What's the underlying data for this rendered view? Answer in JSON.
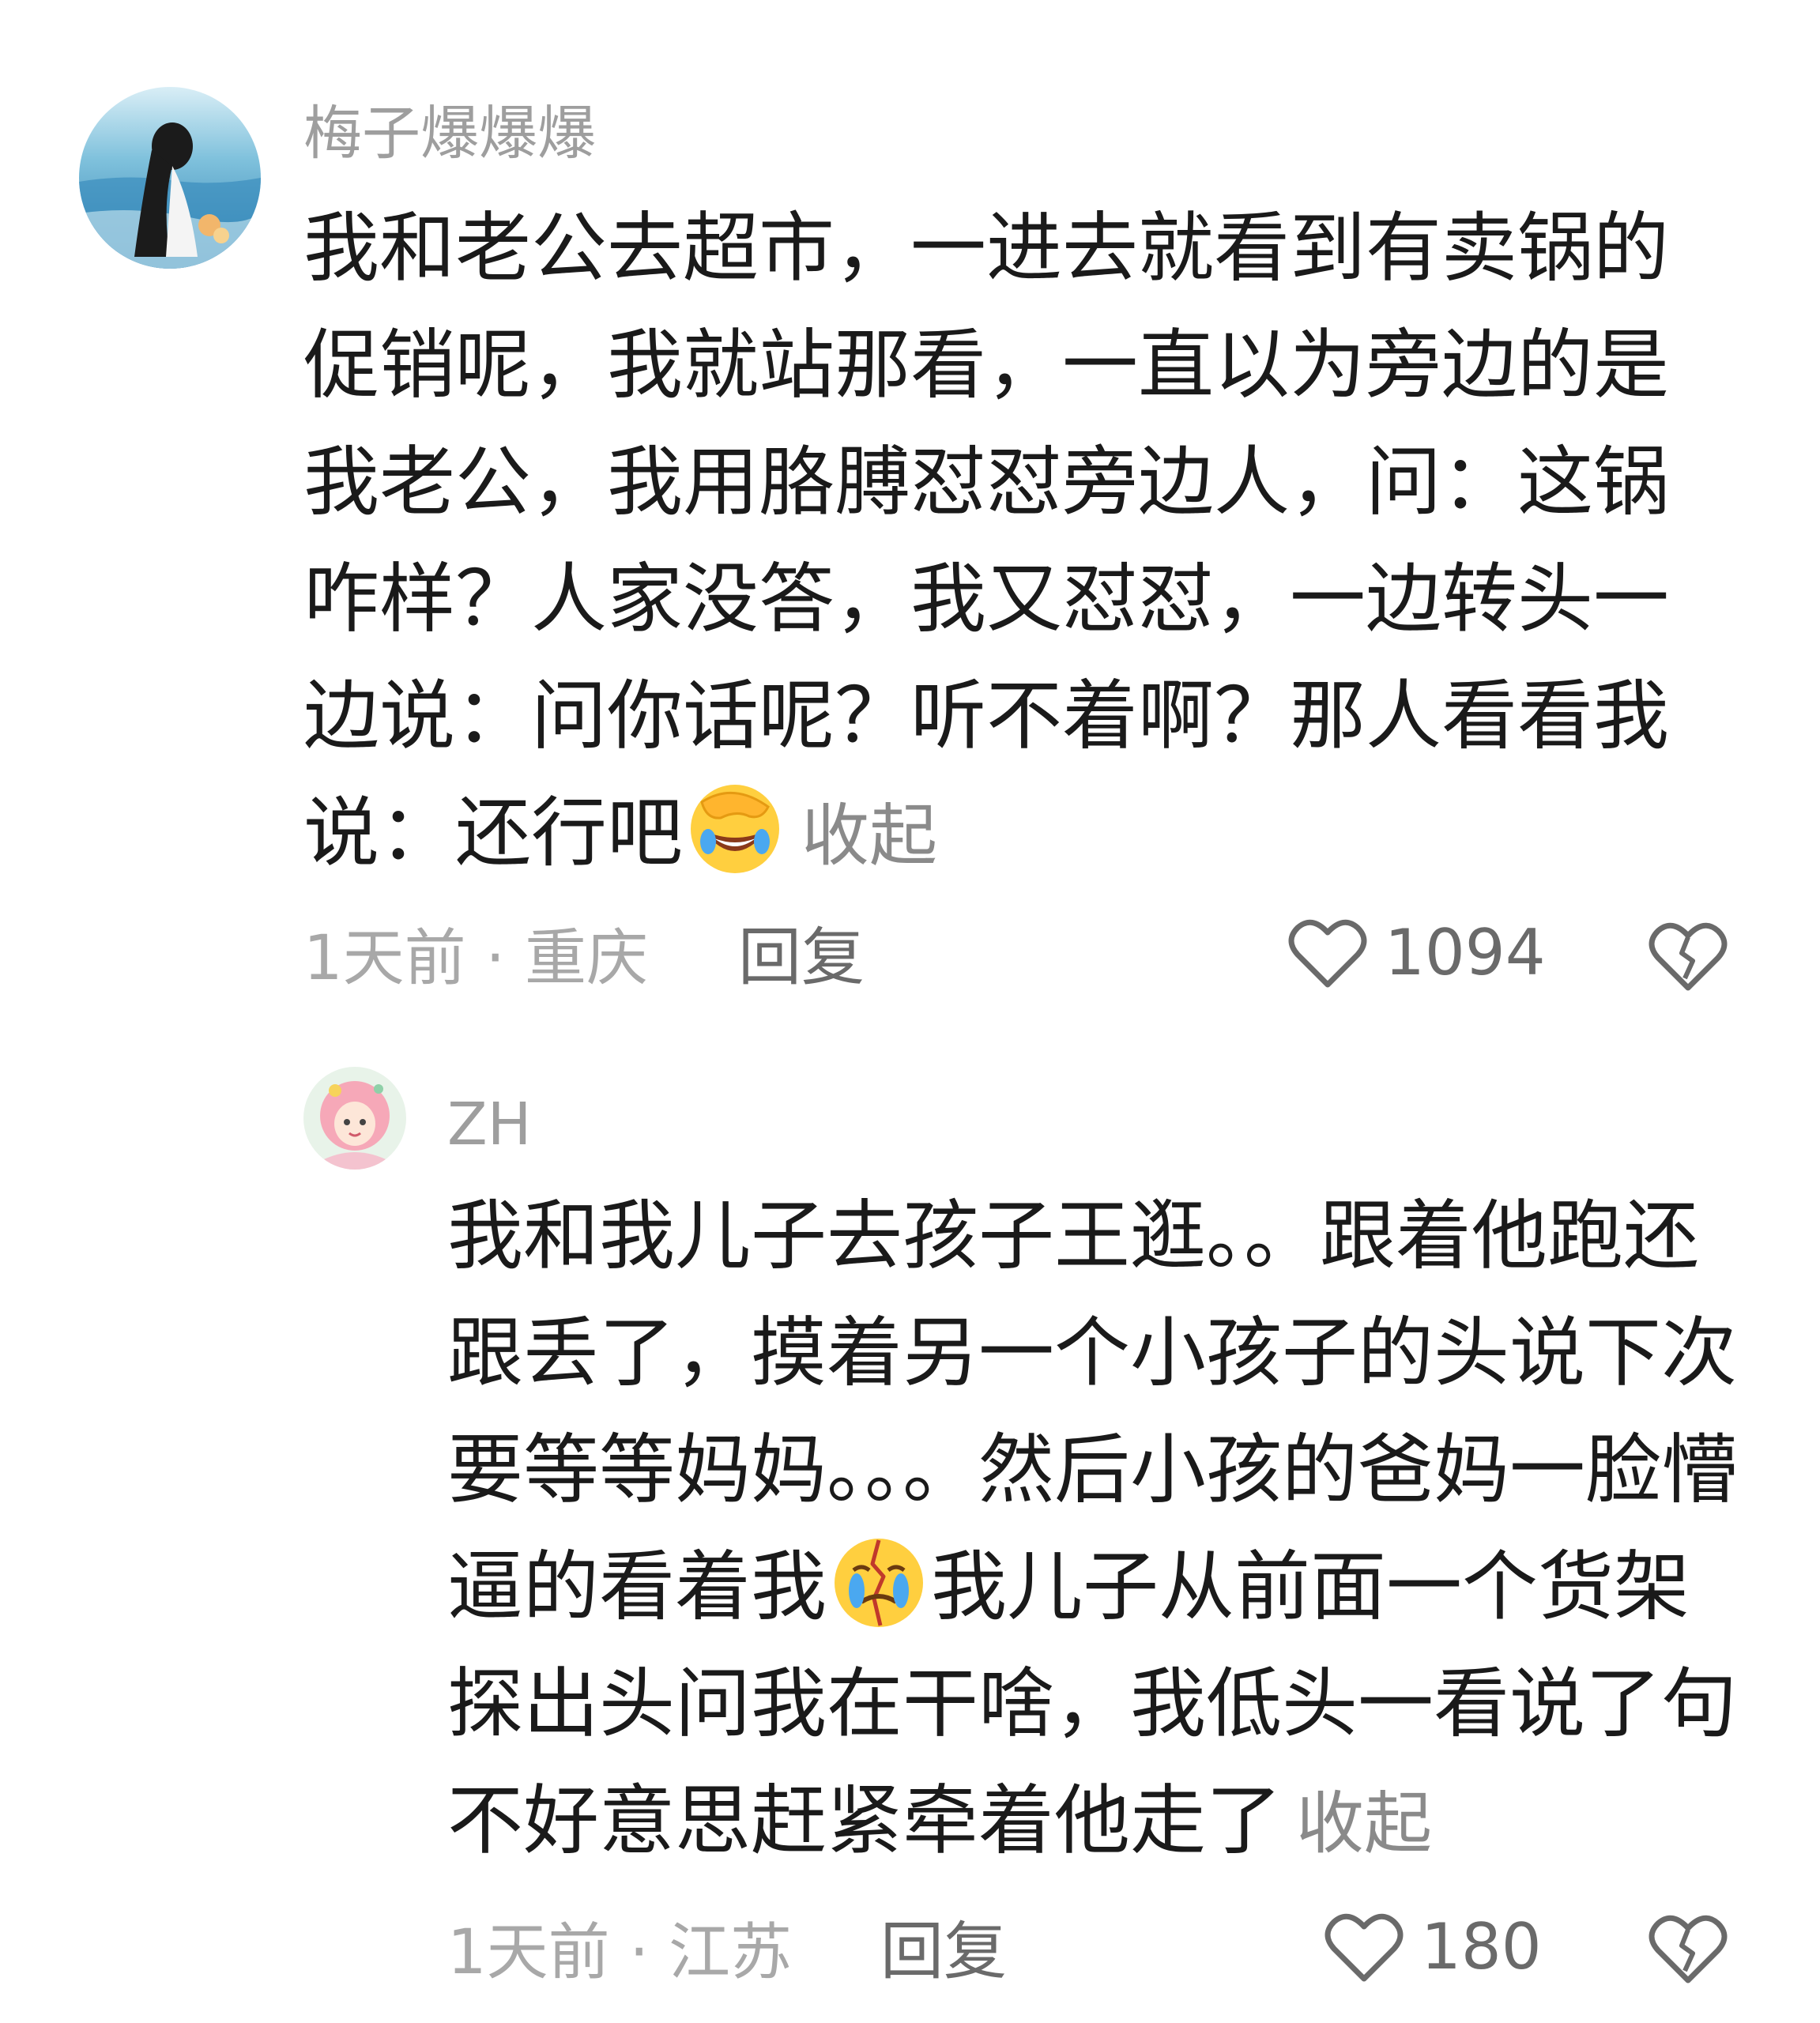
{
  "comments": [
    {
      "username": "梅子爆爆爆",
      "text_before_emoji": "我和老公去超市，一进去就看到有卖锅的促销呢，我就站那看，一直以为旁边的是我老公，我用胳膊怼怼旁边人，问：这锅咋样？人家没答，我又怼怼，一边转头一边说：问你话呢？听不着啊？那人看看我说：还行吧",
      "text_after_emoji": "",
      "emoji": "facepalm-laughing-emoji",
      "collapse_label": "收起",
      "time": "1天前",
      "location": "重庆",
      "meta_separator": " · ",
      "reply_label": "回复",
      "like_count": "1094"
    },
    {
      "username": "ZH",
      "text_before_emoji": "我和我儿子去孩子王逛。。跟着他跑还跟丢了，摸着另一个小孩子的头说下次要等等妈妈。。。然后小孩的爸妈一脸懵逼的看着我",
      "text_after_emoji": "我儿子从前面一个货架探出头问我在干啥，我低头一看说了句不好意思赶紧牵着他走了",
      "emoji": "crying-broken-emoji",
      "collapse_label": "收起",
      "time": "1天前",
      "location": "江苏",
      "meta_separator": " · ",
      "reply_label": "回复",
      "like_count": "180"
    }
  ],
  "colors": {
    "text": "#1a1a1a",
    "muted": "#9e9e9e",
    "icon": "#6a6a6a"
  }
}
